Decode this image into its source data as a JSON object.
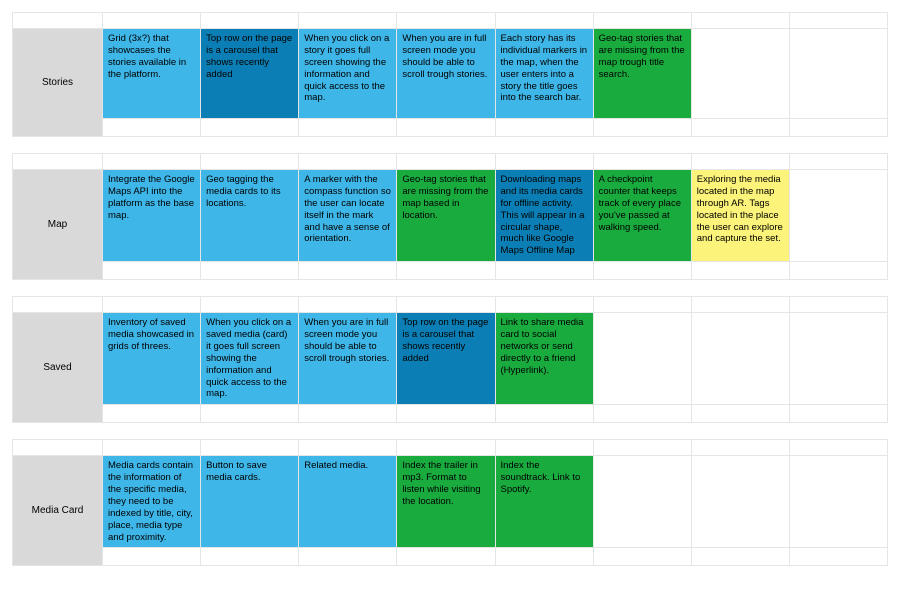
{
  "colors": {
    "lblue": "#3fb6e8",
    "blue": "#0b7fb5",
    "green": "#1aab3f",
    "yellow": "#fcf37a",
    "label_bg": "#d9d9d9"
  },
  "sections": [
    {
      "label": "Stories",
      "cells": [
        {
          "color": "lblue",
          "text": "Grid (3x?) that showcases the stories available in the platform."
        },
        {
          "color": "blue",
          "text": "Top row on the page is a carousel that shows recently added"
        },
        {
          "color": "lblue",
          "text": "When you click on a story it goes full screen showing the information and quick access to the map."
        },
        {
          "color": "lblue",
          "text": "When you are in full screen mode you should be able to scroll trough stories."
        },
        {
          "color": "lblue",
          "text": "Each story has its individual markers in the map, when the user enters into a story the title goes into the search bar."
        },
        {
          "color": "green",
          "text": "Geo-tag stories that are missing from the map trough title search."
        },
        {
          "color": "empty",
          "text": ""
        },
        {
          "color": "empty",
          "text": ""
        }
      ]
    },
    {
      "label": "Map",
      "cells": [
        {
          "color": "lblue",
          "text": "Integrate the Google Maps API into the platform as the base map."
        },
        {
          "color": "lblue",
          "text": "Geo tagging the media cards to its locations."
        },
        {
          "color": "lblue",
          "text": "A marker with the compass function so the user can locate itself in the mark and have a sense of orientation."
        },
        {
          "color": "green",
          "text": "Geo-tag stories that are missing from the map based in location."
        },
        {
          "color": "blue",
          "text": "Downloading maps and its media cards for offline activity. This will appear in a circular shape, much like Google Maps Offline Map"
        },
        {
          "color": "green",
          "text": "A checkpoint counter that keeps track of every place you've passed at walking speed."
        },
        {
          "color": "yellow",
          "text": "Exploring the media located in the map through AR. Tags located in the place the user can explore and capture the set."
        },
        {
          "color": "empty",
          "text": ""
        }
      ]
    },
    {
      "label": "Saved",
      "cells": [
        {
          "color": "lblue",
          "text": "Inventory of saved media showcased in grids of threes."
        },
        {
          "color": "lblue",
          "text": "When you click on a saved media (card) it goes full screen showing the information and quick access to the map."
        },
        {
          "color": "lblue",
          "text": "When you are in full screen mode you should be able to scroll trough stories."
        },
        {
          "color": "blue",
          "text": "Top row on the page is a carousel that shows recently added"
        },
        {
          "color": "green",
          "text": "Link to share media card to social networks or send directly to a friend (Hyperlink)."
        },
        {
          "color": "empty",
          "text": ""
        },
        {
          "color": "empty",
          "text": ""
        },
        {
          "color": "empty",
          "text": ""
        }
      ]
    },
    {
      "label": "Media Card",
      "cells": [
        {
          "color": "lblue",
          "text": "Media cards contain the information of the specific media, they need to be indexed by title, city, place, media type and proximity."
        },
        {
          "color": "lblue",
          "text": "Button to save media cards."
        },
        {
          "color": "lblue",
          "text": "Related media."
        },
        {
          "color": "green",
          "text": "Index the trailer in mp3. Format to listen while visiting the location."
        },
        {
          "color": "green",
          "text": "Index the soundtrack. Link to Spotify."
        },
        {
          "color": "empty",
          "text": ""
        },
        {
          "color": "empty",
          "text": ""
        },
        {
          "color": "empty",
          "text": ""
        }
      ]
    }
  ]
}
